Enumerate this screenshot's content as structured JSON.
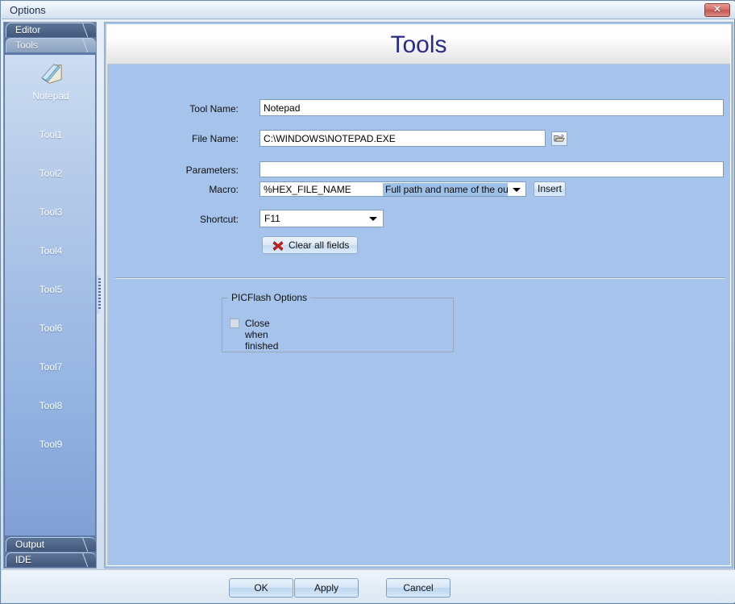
{
  "window": {
    "title": "Options",
    "close_label": "✕"
  },
  "nav": {
    "top_tabs": [
      {
        "label": "Editor",
        "selected": true
      },
      {
        "label": "Tools",
        "selected": false
      }
    ],
    "bottom_tabs": [
      {
        "label": "Output",
        "selected": true
      },
      {
        "label": "IDE",
        "selected": true
      }
    ]
  },
  "sidebar": {
    "icon_name": "notepad-icon",
    "items": [
      {
        "label": "Notepad",
        "has_icon": true
      },
      {
        "label": "Tool1",
        "has_icon": false
      },
      {
        "label": "Tool2",
        "has_icon": false
      },
      {
        "label": "Tool3",
        "has_icon": false
      },
      {
        "label": "Tool4",
        "has_icon": false
      },
      {
        "label": "Tool5",
        "has_icon": false
      },
      {
        "label": "Tool6",
        "has_icon": false
      },
      {
        "label": "Tool7",
        "has_icon": false
      },
      {
        "label": "Tool8",
        "has_icon": false
      },
      {
        "label": "Tool9",
        "has_icon": false
      }
    ]
  },
  "page": {
    "title": "Tools"
  },
  "form": {
    "tool_name": {
      "label": "Tool Name:",
      "value": "Notepad",
      "placeholder": ""
    },
    "file_name": {
      "label": "File Name:",
      "value": "C:\\WINDOWS\\NOTEPAD.EXE",
      "placeholder": "",
      "browse_icon": "folder-open-icon"
    },
    "parameters": {
      "label": "Parameters:",
      "value": "",
      "placeholder": ""
    },
    "macro": {
      "label": "Macro:",
      "value": "%HEX_FILE_NAME",
      "description": "Full path and name of the out…",
      "insert_label": "Insert"
    },
    "shortcut": {
      "label": "Shortcut:",
      "value": "F11"
    },
    "clear_button": {
      "label": "Clear all fields",
      "icon": "red-x-icon"
    }
  },
  "group": {
    "title": "PICFlash Options",
    "checkbox": {
      "label": "Close when finished",
      "checked": false
    }
  },
  "buttons": {
    "ok": "OK",
    "apply": "Apply",
    "cancel": "Cancel"
  },
  "colors": {
    "panel_bg": "#a6c3ec",
    "title_accent": "#2a2a8a",
    "highlight": "#9dc0e8",
    "close_red": "#c4554f"
  }
}
